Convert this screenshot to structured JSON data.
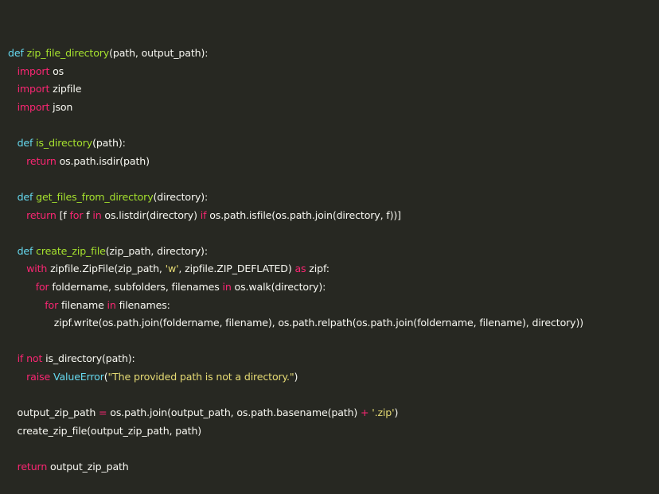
{
  "theme": {
    "background": "#272822",
    "text": "#f8f8f2",
    "keyword": "#f92672",
    "definition": "#66d9ef",
    "function_name": "#a6e22e",
    "string": "#e6db74"
  },
  "code": {
    "lines": [
      [
        {
          "t": "def ",
          "c": "def"
        },
        {
          "t": "zip_file_directory",
          "c": "fn"
        },
        {
          "t": "(path, output_path):"
        }
      ],
      [
        {
          "t": "   "
        },
        {
          "t": "import",
          "c": "kw"
        },
        {
          "t": " os"
        }
      ],
      [
        {
          "t": "   "
        },
        {
          "t": "import",
          "c": "kw"
        },
        {
          "t": " zipfile"
        }
      ],
      [
        {
          "t": "   "
        },
        {
          "t": "import",
          "c": "kw"
        },
        {
          "t": " json"
        }
      ],
      [],
      [
        {
          "t": "   "
        },
        {
          "t": "def ",
          "c": "def"
        },
        {
          "t": "is_directory",
          "c": "fn"
        },
        {
          "t": "(path):"
        }
      ],
      [
        {
          "t": "      "
        },
        {
          "t": "return",
          "c": "kw"
        },
        {
          "t": " os.path.isdir(path)"
        }
      ],
      [],
      [
        {
          "t": "   "
        },
        {
          "t": "def ",
          "c": "def"
        },
        {
          "t": "get_files_from_directory",
          "c": "fn"
        },
        {
          "t": "(directory):"
        }
      ],
      [
        {
          "t": "      "
        },
        {
          "t": "return",
          "c": "kw"
        },
        {
          "t": " [f "
        },
        {
          "t": "for",
          "c": "kw"
        },
        {
          "t": " f "
        },
        {
          "t": "in",
          "c": "kw"
        },
        {
          "t": " os.listdir(directory) "
        },
        {
          "t": "if",
          "c": "kw"
        },
        {
          "t": " os.path.isfile(os.path.join(directory, f))]"
        }
      ],
      [],
      [
        {
          "t": "   "
        },
        {
          "t": "def ",
          "c": "def"
        },
        {
          "t": "create_zip_file",
          "c": "fn"
        },
        {
          "t": "(zip_path, directory):"
        }
      ],
      [
        {
          "t": "      "
        },
        {
          "t": "with",
          "c": "kw"
        },
        {
          "t": " zipfile.ZipFile(zip_path, "
        },
        {
          "t": "'w'",
          "c": "str"
        },
        {
          "t": ", zipfile.ZIP_DEFLATED) "
        },
        {
          "t": "as",
          "c": "kw"
        },
        {
          "t": " zipf:"
        }
      ],
      [
        {
          "t": "         "
        },
        {
          "t": "for",
          "c": "kw"
        },
        {
          "t": " foldername, subfolders, filenames "
        },
        {
          "t": "in",
          "c": "kw"
        },
        {
          "t": " os.walk(directory):"
        }
      ],
      [
        {
          "t": "            "
        },
        {
          "t": "for",
          "c": "kw"
        },
        {
          "t": " filename "
        },
        {
          "t": "in",
          "c": "kw"
        },
        {
          "t": " filenames:"
        }
      ],
      [
        {
          "t": "               zipf.write(os.path.join(foldername, filename), os.path.relpath(os.path.join(foldername, filename), directory))"
        }
      ],
      [],
      [
        {
          "t": "   "
        },
        {
          "t": "if",
          "c": "kw"
        },
        {
          "t": " "
        },
        {
          "t": "not",
          "c": "kw"
        },
        {
          "t": " is_directory(path):"
        }
      ],
      [
        {
          "t": "      "
        },
        {
          "t": "raise",
          "c": "kw"
        },
        {
          "t": " "
        },
        {
          "t": "ValueError",
          "c": "cls"
        },
        {
          "t": "("
        },
        {
          "t": "\"The provided path is not a directory.\"",
          "c": "str"
        },
        {
          "t": ")"
        }
      ],
      [],
      [
        {
          "t": "   output_zip_path "
        },
        {
          "t": "=",
          "c": "kw"
        },
        {
          "t": " os.path.join(output_path, os.path.basename(path) "
        },
        {
          "t": "+",
          "c": "kw"
        },
        {
          "t": " "
        },
        {
          "t": "'.zip'",
          "c": "str"
        },
        {
          "t": ")"
        }
      ],
      [
        {
          "t": "   create_zip_file(output_zip_path, path)"
        }
      ],
      [],
      [
        {
          "t": "   "
        },
        {
          "t": "return",
          "c": "kw"
        },
        {
          "t": " output_zip_path"
        }
      ]
    ]
  }
}
